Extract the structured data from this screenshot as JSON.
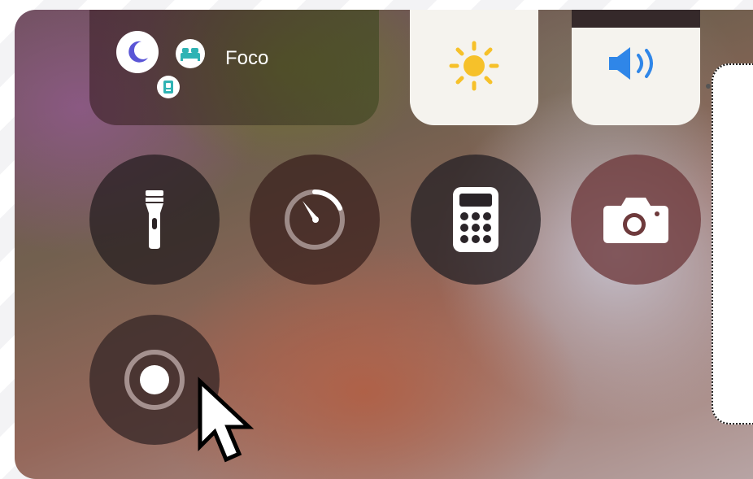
{
  "focus": {
    "label": "Foco",
    "icons": [
      "moon-icon",
      "bed-icon",
      "id-badge-icon"
    ],
    "colors": {
      "moon": "#5a55d6",
      "bed": "#2fb3b4",
      "id": "#2fb3b4"
    }
  },
  "sliders": {
    "brightness": {
      "icon": "sun-icon",
      "level": 1.0,
      "icon_color": "#f6c12a"
    },
    "volume": {
      "icon": "speaker-icon",
      "level": 0.85,
      "icon_color": "#2f86e8"
    }
  },
  "controls": [
    {
      "name": "flashlight",
      "icon": "flashlight-icon"
    },
    {
      "name": "timer",
      "icon": "timer-icon"
    },
    {
      "name": "calculator",
      "icon": "calculator-icon"
    },
    {
      "name": "camera",
      "icon": "camera-icon"
    },
    {
      "name": "screen-recording",
      "icon": "record-icon"
    }
  ],
  "pointer": {
    "icon": "mouse-pointer-icon"
  }
}
